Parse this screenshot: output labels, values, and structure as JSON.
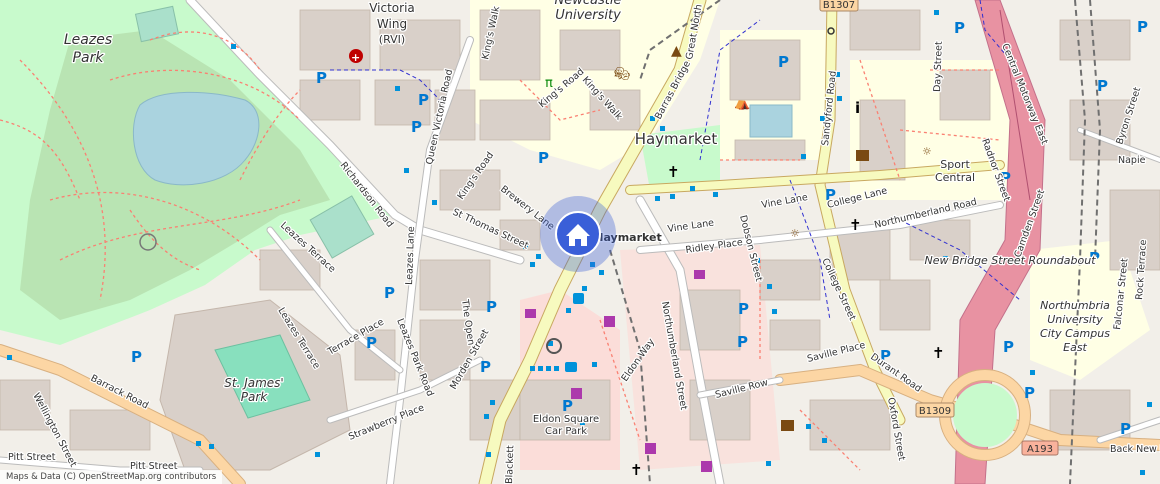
{
  "attribution": "Maps & Data (C) OpenStreetMap.org contributors",
  "marker": {
    "icon": "home-icon",
    "color": "#3a5fd8"
  },
  "labels": {
    "victoria_wing": "Victoria",
    "wing": "Wing",
    "rvi": "(RVI)",
    "newcastle": "Newcastle",
    "university": "University",
    "leazes": "Leazes",
    "park": "Park",
    "st_james": "St. James'",
    "st_james_park": "Park",
    "haymarket_area": "Haymarket",
    "haymarket_stop": "Haymarket",
    "sport": "Sport",
    "central": "Central",
    "northumbria": "Northumbria",
    "northumbria2": "University",
    "northumbria3": "City Campus",
    "northumbria4": "East",
    "eldon_square": "Eldon Square",
    "car_park": "Car Park",
    "roundabout": "New Bridge Street Roundabout",
    "b1307": "B1307",
    "b1309": "B1309",
    "a193": "A193"
  },
  "streets": {
    "barrack_road": "Barrack Road",
    "richardson_road": "Richardson Road",
    "queen_victoria_road": "Queen Victoria Road",
    "kings_walk": "King's Walk",
    "kings_road": "King's Road",
    "kings_road2": "King's Road",
    "kings_walk2": "King's Walk",
    "great_north": "Great North",
    "barras_bridge": "Barras Bridge",
    "sandyford_road": "Sandyford Road",
    "day_street": "Day Street",
    "central_motorway": "Central Motorway East",
    "st_thomas_street": "St Thomas Street",
    "brewery_lane": "Brewery Lane",
    "leazes_terrace": "Leazes Terrace",
    "leazes_terrace2": "Leazes Terrace",
    "leazes_lane": "Leazes Lane",
    "terrace_place": "Terrace Place",
    "leazes_park_road": "Leazes Park Road",
    "the_open": "The Open",
    "morden_street": "Morden Street",
    "strawberry_place": "Strawberry Place",
    "wellington_street": "Wellington Street",
    "pitt_street": "Pitt Street",
    "pitt_street2": "Pitt Street",
    "vine_lane": "Vine Lane",
    "vine_lane2": "Vine Lane",
    "college_lane": "College Lane",
    "ridley_place": "Ridley Place",
    "dobson_street": "Dobson Street",
    "northumberland_road": "Northumberland Road",
    "college_street": "College Street",
    "northumberland_street": "Northumberland Street",
    "eldon_way": "Eldon Way",
    "saville_row": "Saville Row",
    "saville_place": "Saville Place",
    "durant_road": "Durant Road",
    "oxford_street": "Oxford Street",
    "radnor_street": "Radnor Street",
    "camden_street": "Camden Street",
    "falconar_street": "Falconar Street",
    "rock_terrace": "Rock Terrace",
    "byron_street": "Byron Street",
    "napier": "Napie",
    "back_new": "Back New B",
    "bath_lane": "Blackett"
  },
  "colors": {
    "background": "#f2efe9",
    "park": "#c8facc",
    "wood": "#add19e",
    "water": "#aad3df",
    "building": "#d9d0c9",
    "primary_road": "#fcd6a4",
    "trunk_road": "#f9b29c",
    "motorway": "#e892a2",
    "university": "#ffffe5",
    "pitch": "#aae0cb",
    "path": "#fa8072",
    "bus_stop": "#0092da",
    "marker": "#3a5fd8"
  }
}
